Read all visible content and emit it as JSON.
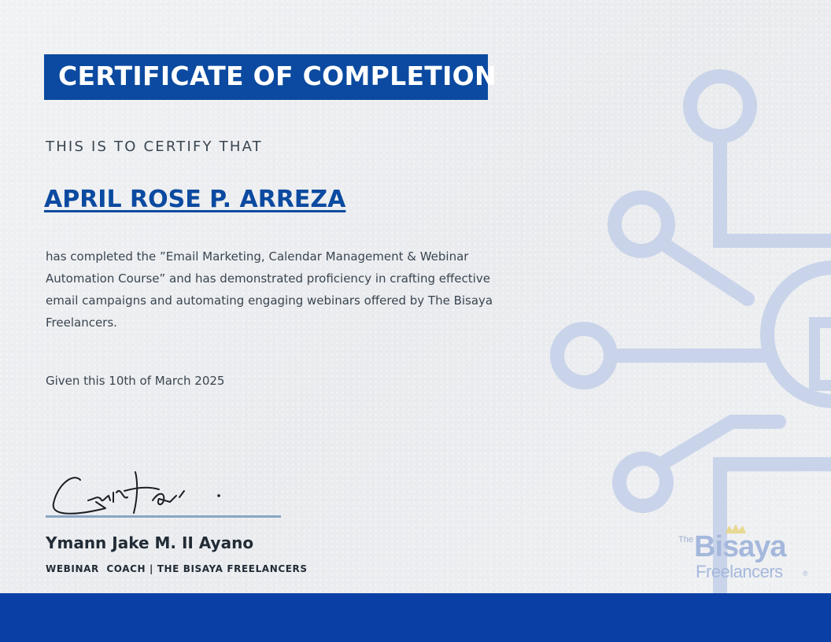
{
  "certificate": {
    "title": "CERTIFICATE OF COMPLETION",
    "certify_line": "THIS IS TO CERTIFY THAT",
    "recipient": "APRIL ROSE P. ARREZA",
    "body": "has completed the ”Email Marketing, Calendar Management & Webinar Automation Course” and has demonstrated proficiency in crafting effective email campaigns and automating engaging webinars offered by The Bisaya Freelancers.",
    "given": "Given this 10th of March 2025"
  },
  "signatory": {
    "name": "Ymann Jake M. II Ayano",
    "role": "WEBINAR  COACH | THE BISAYA FREELANCERS"
  },
  "logo": {
    "prefix": "The",
    "main": "Bisaya",
    "sub": "Freelancers",
    "mark": "®"
  },
  "colors": {
    "primary_blue": "#0b4aa0",
    "footer_blue": "#0a3fa6",
    "circuit_blue": "#c9d4ea",
    "text_dark": "#3a4550"
  },
  "icons": [
    "circuit-graphic",
    "signature-mark",
    "crown-icon"
  ]
}
